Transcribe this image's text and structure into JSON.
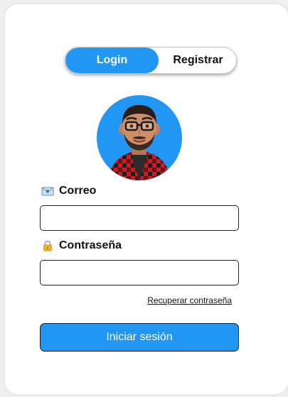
{
  "tabs": {
    "login_label": "Login",
    "register_label": "Registrar",
    "active": "login"
  },
  "form": {
    "email_label": "Correo",
    "email_value": "",
    "password_label": "Contraseña",
    "password_value": "",
    "recover_link": "Recuperar contraseña",
    "submit_label": "Iniciar sesión"
  },
  "icons": {
    "email": "envelope-icon",
    "password": "lock-icon",
    "avatar": "user-avatar"
  },
  "colors": {
    "accent": "#2196f3"
  }
}
